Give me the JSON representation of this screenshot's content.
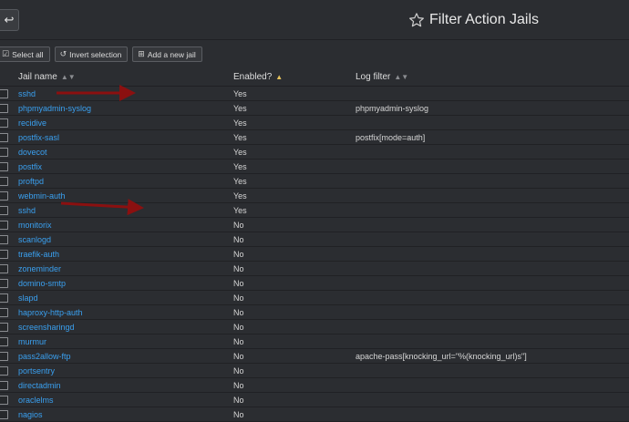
{
  "header": {
    "back_icon": "return-arrow-icon",
    "star_icon": "star-outline-icon",
    "title": "Filter Action Jails"
  },
  "toolbar": {
    "select_all": "Select all",
    "invert_selection": "Invert selection",
    "add_new_jail": "Add a new jail"
  },
  "table": {
    "columns": {
      "name": "Jail name",
      "enabled": "Enabled?",
      "log_filter": "Log filter"
    },
    "rows": [
      {
        "name": "sshd",
        "enabled": "Yes",
        "log_filter": ""
      },
      {
        "name": "phpmyadmin-syslog",
        "enabled": "Yes",
        "log_filter": "phpmyadmin-syslog"
      },
      {
        "name": "recidive",
        "enabled": "Yes",
        "log_filter": ""
      },
      {
        "name": "postfix-sasl",
        "enabled": "Yes",
        "log_filter": "postfix[mode=auth]"
      },
      {
        "name": "dovecot",
        "enabled": "Yes",
        "log_filter": ""
      },
      {
        "name": "postfix",
        "enabled": "Yes",
        "log_filter": ""
      },
      {
        "name": "proftpd",
        "enabled": "Yes",
        "log_filter": ""
      },
      {
        "name": "webmin-auth",
        "enabled": "Yes",
        "log_filter": ""
      },
      {
        "name": "sshd",
        "enabled": "Yes",
        "log_filter": ""
      },
      {
        "name": "monitorix",
        "enabled": "No",
        "log_filter": ""
      },
      {
        "name": "scanlogd",
        "enabled": "No",
        "log_filter": ""
      },
      {
        "name": "traefik-auth",
        "enabled": "No",
        "log_filter": ""
      },
      {
        "name": "zoneminder",
        "enabled": "No",
        "log_filter": ""
      },
      {
        "name": "domino-smtp",
        "enabled": "No",
        "log_filter": ""
      },
      {
        "name": "slapd",
        "enabled": "No",
        "log_filter": ""
      },
      {
        "name": "haproxy-http-auth",
        "enabled": "No",
        "log_filter": ""
      },
      {
        "name": "screensharingd",
        "enabled": "No",
        "log_filter": ""
      },
      {
        "name": "murmur",
        "enabled": "No",
        "log_filter": ""
      },
      {
        "name": "pass2allow-ftp",
        "enabled": "No",
        "log_filter": "apache-pass[knocking_url=\"%(knocking_url)s\"]"
      },
      {
        "name": "portsentry",
        "enabled": "No",
        "log_filter": ""
      },
      {
        "name": "directadmin",
        "enabled": "No",
        "log_filter": ""
      },
      {
        "name": "oraclelms",
        "enabled": "No",
        "log_filter": ""
      },
      {
        "name": "nagios",
        "enabled": "No",
        "log_filter": ""
      }
    ]
  },
  "annotation_color": "#8b1010"
}
